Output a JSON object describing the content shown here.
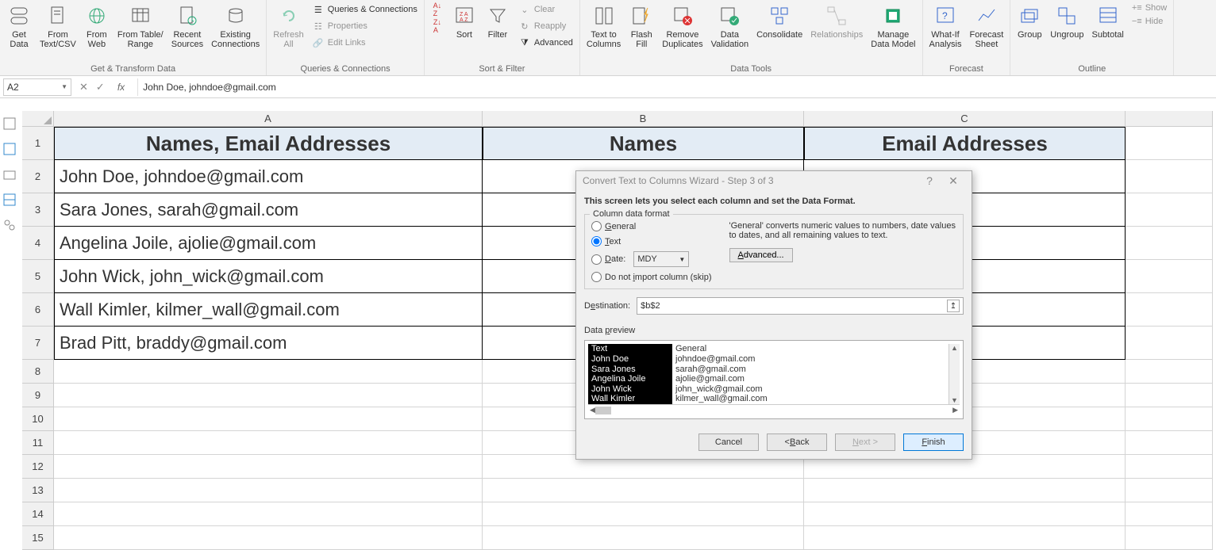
{
  "ribbon": {
    "groups": {
      "get_transform": {
        "label": "Get & Transform Data",
        "get_data": "Get\nData",
        "from_textcsv": "From\nText/CSV",
        "from_web": "From\nWeb",
        "from_table": "From Table/\nRange",
        "recent": "Recent\nSources",
        "existing": "Existing\nConnections"
      },
      "queries": {
        "label": "Queries & Connections",
        "refresh": "Refresh\nAll",
        "qc": "Queries & Connections",
        "props": "Properties",
        "edit_links": "Edit Links"
      },
      "sort_filter": {
        "label": "Sort & Filter",
        "sort": "Sort",
        "filter": "Filter",
        "clear": "Clear",
        "reapply": "Reapply",
        "advanced": "Advanced"
      },
      "data_tools": {
        "label": "Data Tools",
        "text_cols": "Text to\nColumns",
        "flash": "Flash\nFill",
        "remove_dup": "Remove\nDuplicates",
        "validation": "Data\nValidation",
        "consolidate": "Consolidate",
        "relationships": "Relationships",
        "data_model": "Manage\nData Model"
      },
      "forecast": {
        "label": "Forecast",
        "whatif": "What-If\nAnalysis",
        "sheet": "Forecast\nSheet"
      },
      "outline": {
        "label": "Outline",
        "group": "Group",
        "ungroup": "Ungroup",
        "subtotal": "Subtotal",
        "show": "Show",
        "hide": "Hide"
      }
    }
  },
  "formula_bar": {
    "cell_ref": "A2",
    "content": "John Doe, johndoe@gmail.com"
  },
  "columns": {
    "A": "A",
    "B": "B",
    "C": "C",
    "D": ""
  },
  "headers": {
    "A": "Names, Email Addresses",
    "B": "Names",
    "C": "Email Addresses"
  },
  "rows": [
    "John Doe, johndoe@gmail.com",
    "Sara Jones, sarah@gmail.com",
    "Angelina Joile, ajolie@gmail.com",
    "John Wick, john_wick@gmail.com",
    "Wall Kimler, kilmer_wall@gmail.com",
    "Brad Pitt, braddy@gmail.com"
  ],
  "dialog": {
    "title": "Convert Text to Columns Wizard - Step 3 of 3",
    "intro": "This screen lets you select each column and set the Data Format.",
    "format_legend": "Column data format",
    "opt_general": "General",
    "opt_text": "Text",
    "opt_date": "Date:",
    "date_value": "MDY",
    "opt_skip": "Do not import column (skip)",
    "help_text": "'General' converts numeric values to numbers, date values to dates, and all remaining values to text.",
    "advanced": "Advanced...",
    "dest_label": "Destination:",
    "dest_value": "$b$2",
    "preview_label": "Data preview",
    "preview_headers": [
      "Text",
      "General"
    ],
    "preview_rows": [
      [
        "John Doe",
        "johndoe@gmail.com"
      ],
      [
        "Sara Jones",
        "sarah@gmail.com"
      ],
      [
        "Angelina Joile",
        "ajolie@gmail.com"
      ],
      [
        "John Wick",
        "john_wick@gmail.com"
      ],
      [
        "Wall Kimler",
        "kilmer_wall@gmail.com"
      ]
    ],
    "btn_cancel": "Cancel",
    "btn_back": "< Back",
    "btn_next": "Next >",
    "btn_finish": "Finish"
  }
}
